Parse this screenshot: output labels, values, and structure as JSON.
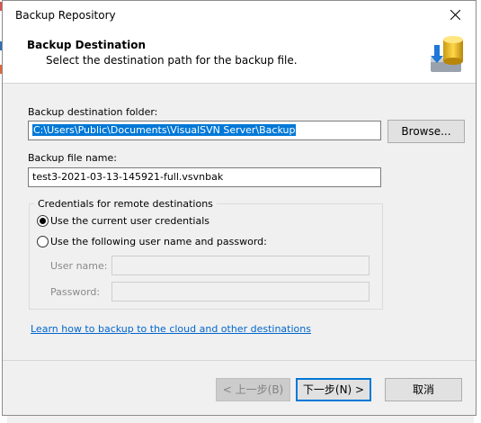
{
  "window": {
    "title": "Backup Repository"
  },
  "header": {
    "title": "Backup Destination",
    "subtitle": "Select the destination path for the backup file.",
    "icon": "database-backup-icon"
  },
  "folder": {
    "label": "Backup destination folder:",
    "value": "C:\\Users\\Public\\Documents\\VisualSVN Server\\Backup",
    "browse_label": "Browse..."
  },
  "file": {
    "label": "Backup file name:",
    "value": "test3-2021-03-13-145921-full.vsvnbak"
  },
  "credentials": {
    "group_title": "Credentials for remote destinations",
    "option_current": "Use the current user credentials",
    "option_custom": "Use the following user name and password:",
    "selected": "current",
    "username_label": "User name:",
    "password_label": "Password:"
  },
  "link": {
    "text": "Learn how to backup to the cloud and other destinations"
  },
  "footer": {
    "back_label": "< 上一步(B)",
    "next_label": "下一步(N) >",
    "cancel_label": "取消"
  },
  "colors": {
    "accent": "#0078d7",
    "link": "#0066cc"
  }
}
